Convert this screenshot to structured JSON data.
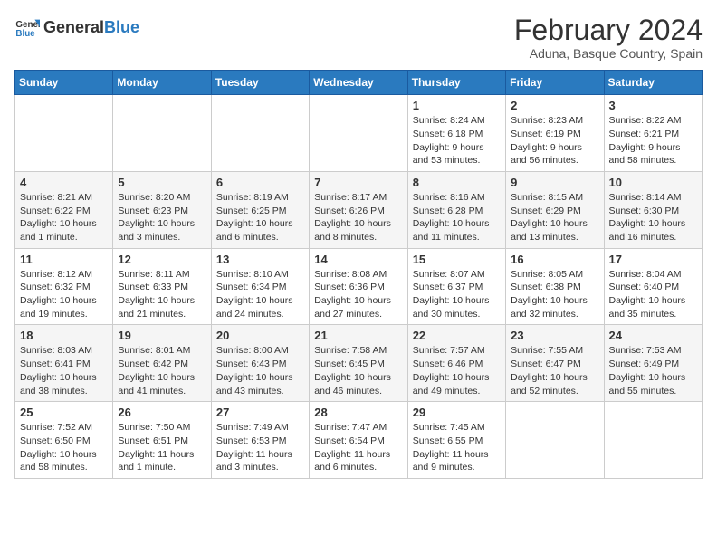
{
  "logo": {
    "text_general": "General",
    "text_blue": "Blue"
  },
  "header": {
    "title": "February 2024",
    "subtitle": "Aduna, Basque Country, Spain"
  },
  "weekdays": [
    "Sunday",
    "Monday",
    "Tuesday",
    "Wednesday",
    "Thursday",
    "Friday",
    "Saturday"
  ],
  "weeks": [
    [
      {
        "day": "",
        "info": ""
      },
      {
        "day": "",
        "info": ""
      },
      {
        "day": "",
        "info": ""
      },
      {
        "day": "",
        "info": ""
      },
      {
        "day": "1",
        "info": "Sunrise: 8:24 AM\nSunset: 6:18 PM\nDaylight: 9 hours\nand 53 minutes."
      },
      {
        "day": "2",
        "info": "Sunrise: 8:23 AM\nSunset: 6:19 PM\nDaylight: 9 hours\nand 56 minutes."
      },
      {
        "day": "3",
        "info": "Sunrise: 8:22 AM\nSunset: 6:21 PM\nDaylight: 9 hours\nand 58 minutes."
      }
    ],
    [
      {
        "day": "4",
        "info": "Sunrise: 8:21 AM\nSunset: 6:22 PM\nDaylight: 10 hours\nand 1 minute."
      },
      {
        "day": "5",
        "info": "Sunrise: 8:20 AM\nSunset: 6:23 PM\nDaylight: 10 hours\nand 3 minutes."
      },
      {
        "day": "6",
        "info": "Sunrise: 8:19 AM\nSunset: 6:25 PM\nDaylight: 10 hours\nand 6 minutes."
      },
      {
        "day": "7",
        "info": "Sunrise: 8:17 AM\nSunset: 6:26 PM\nDaylight: 10 hours\nand 8 minutes."
      },
      {
        "day": "8",
        "info": "Sunrise: 8:16 AM\nSunset: 6:28 PM\nDaylight: 10 hours\nand 11 minutes."
      },
      {
        "day": "9",
        "info": "Sunrise: 8:15 AM\nSunset: 6:29 PM\nDaylight: 10 hours\nand 13 minutes."
      },
      {
        "day": "10",
        "info": "Sunrise: 8:14 AM\nSunset: 6:30 PM\nDaylight: 10 hours\nand 16 minutes."
      }
    ],
    [
      {
        "day": "11",
        "info": "Sunrise: 8:12 AM\nSunset: 6:32 PM\nDaylight: 10 hours\nand 19 minutes."
      },
      {
        "day": "12",
        "info": "Sunrise: 8:11 AM\nSunset: 6:33 PM\nDaylight: 10 hours\nand 21 minutes."
      },
      {
        "day": "13",
        "info": "Sunrise: 8:10 AM\nSunset: 6:34 PM\nDaylight: 10 hours\nand 24 minutes."
      },
      {
        "day": "14",
        "info": "Sunrise: 8:08 AM\nSunset: 6:36 PM\nDaylight: 10 hours\nand 27 minutes."
      },
      {
        "day": "15",
        "info": "Sunrise: 8:07 AM\nSunset: 6:37 PM\nDaylight: 10 hours\nand 30 minutes."
      },
      {
        "day": "16",
        "info": "Sunrise: 8:05 AM\nSunset: 6:38 PM\nDaylight: 10 hours\nand 32 minutes."
      },
      {
        "day": "17",
        "info": "Sunrise: 8:04 AM\nSunset: 6:40 PM\nDaylight: 10 hours\nand 35 minutes."
      }
    ],
    [
      {
        "day": "18",
        "info": "Sunrise: 8:03 AM\nSunset: 6:41 PM\nDaylight: 10 hours\nand 38 minutes."
      },
      {
        "day": "19",
        "info": "Sunrise: 8:01 AM\nSunset: 6:42 PM\nDaylight: 10 hours\nand 41 minutes."
      },
      {
        "day": "20",
        "info": "Sunrise: 8:00 AM\nSunset: 6:43 PM\nDaylight: 10 hours\nand 43 minutes."
      },
      {
        "day": "21",
        "info": "Sunrise: 7:58 AM\nSunset: 6:45 PM\nDaylight: 10 hours\nand 46 minutes."
      },
      {
        "day": "22",
        "info": "Sunrise: 7:57 AM\nSunset: 6:46 PM\nDaylight: 10 hours\nand 49 minutes."
      },
      {
        "day": "23",
        "info": "Sunrise: 7:55 AM\nSunset: 6:47 PM\nDaylight: 10 hours\nand 52 minutes."
      },
      {
        "day": "24",
        "info": "Sunrise: 7:53 AM\nSunset: 6:49 PM\nDaylight: 10 hours\nand 55 minutes."
      }
    ],
    [
      {
        "day": "25",
        "info": "Sunrise: 7:52 AM\nSunset: 6:50 PM\nDaylight: 10 hours\nand 58 minutes."
      },
      {
        "day": "26",
        "info": "Sunrise: 7:50 AM\nSunset: 6:51 PM\nDaylight: 11 hours\nand 1 minute."
      },
      {
        "day": "27",
        "info": "Sunrise: 7:49 AM\nSunset: 6:53 PM\nDaylight: 11 hours\nand 3 minutes."
      },
      {
        "day": "28",
        "info": "Sunrise: 7:47 AM\nSunset: 6:54 PM\nDaylight: 11 hours\nand 6 minutes."
      },
      {
        "day": "29",
        "info": "Sunrise: 7:45 AM\nSunset: 6:55 PM\nDaylight: 11 hours\nand 9 minutes."
      },
      {
        "day": "",
        "info": ""
      },
      {
        "day": "",
        "info": ""
      }
    ]
  ]
}
